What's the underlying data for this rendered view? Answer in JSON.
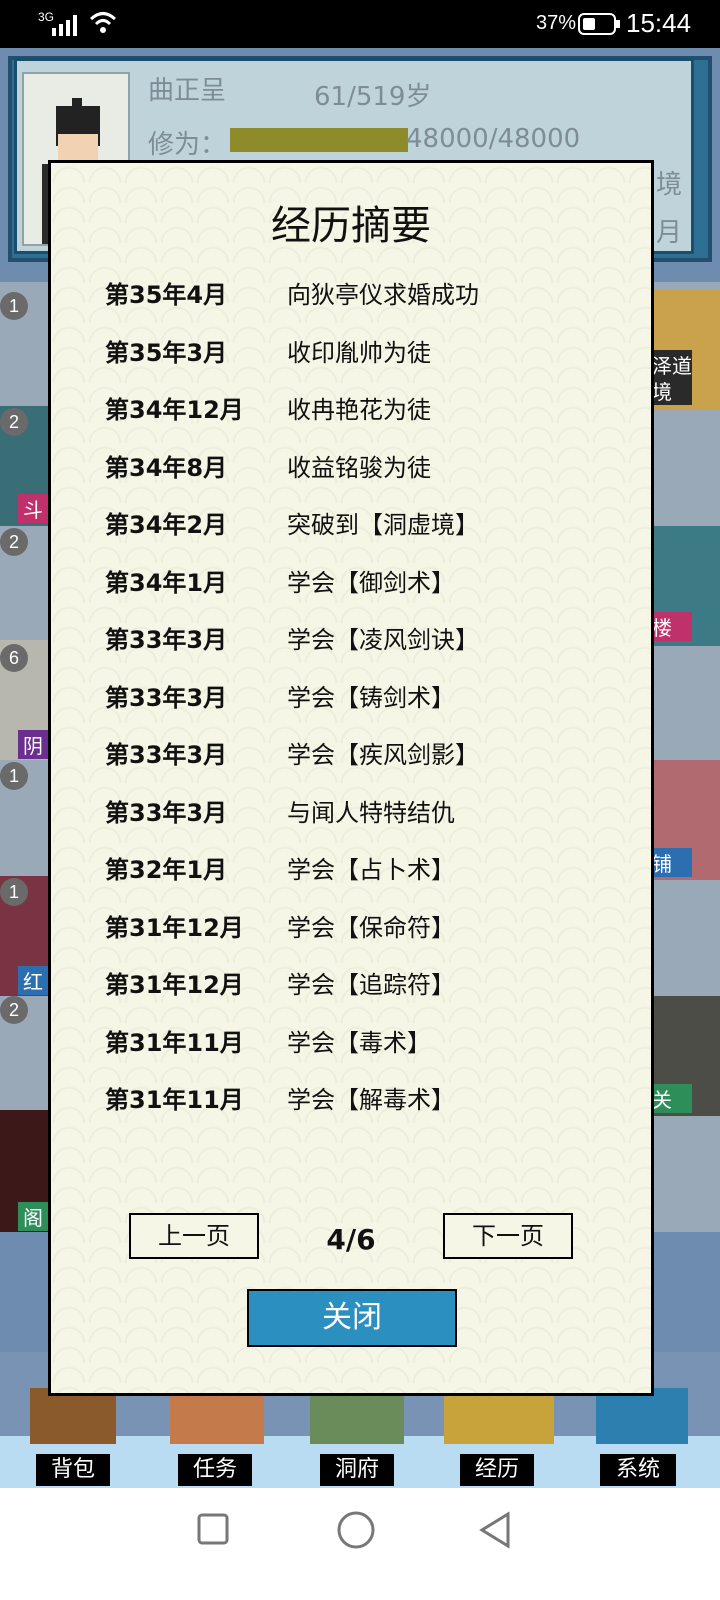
{
  "status_bar": {
    "network": "3G",
    "battery": "37%",
    "time": "15:44"
  },
  "profile": {
    "name": "曲正呈",
    "age": "61/519岁",
    "cultivation_label": "修为：",
    "cultivation_value": "48000/48000",
    "cultivation_progress": 1.0,
    "partial_right_1": "境",
    "partial_right_2": "月"
  },
  "bg_badges": [
    "1",
    "2",
    "2",
    "6",
    "1",
    "1",
    "2"
  ],
  "bg_side_labels": [
    "斗",
    "阴",
    "红",
    "阁",
    "楼",
    "铺",
    "关"
  ],
  "bg_top_right": {
    "line1": "泽道",
    "line2": "境"
  },
  "modal": {
    "title": "经历摘要",
    "rows": [
      {
        "date": "第35年4月",
        "event": "向狄亭仪求婚成功"
      },
      {
        "date": "第35年3月",
        "event": "收印胤帅为徒"
      },
      {
        "date": "第34年12月",
        "event": "收冉艳花为徒"
      },
      {
        "date": "第34年8月",
        "event": "收益铭骏为徒"
      },
      {
        "date": "第34年2月",
        "event": "突破到【洞虚境】"
      },
      {
        "date": "第34年1月",
        "event": "学会【御剑术】"
      },
      {
        "date": "第33年3月",
        "event": "学会【凌风剑诀】"
      },
      {
        "date": "第33年3月",
        "event": "学会【铸剑术】"
      },
      {
        "date": "第33年3月",
        "event": "学会【疾风剑影】"
      },
      {
        "date": "第33年3月",
        "event": "与闻人特特结仇"
      },
      {
        "date": "第32年1月",
        "event": "学会【占卜术】"
      },
      {
        "date": "第31年12月",
        "event": "学会【保命符】"
      },
      {
        "date": "第31年12月",
        "event": "学会【追踪符】"
      },
      {
        "date": "第31年11月",
        "event": "学会【毒术】"
      },
      {
        "date": "第31年11月",
        "event": "学会【解毒术】"
      }
    ],
    "prev_label": "上一页",
    "next_label": "下一页",
    "page": "4/6",
    "close_label": "关闭"
  },
  "dock": [
    "背包",
    "任务",
    "洞府",
    "经历",
    "系统"
  ],
  "nav_icons": [
    "square-icon",
    "circle-icon",
    "triangle-back-icon"
  ]
}
